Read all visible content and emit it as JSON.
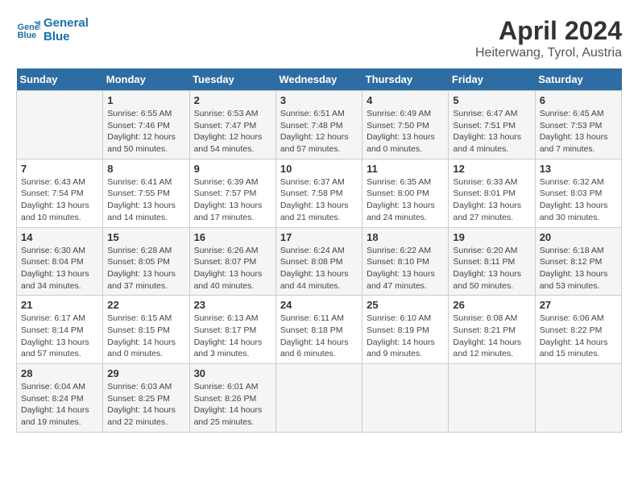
{
  "logo": {
    "line1": "General",
    "line2": "Blue"
  },
  "title": "April 2024",
  "subtitle": "Heiterwang, Tyrol, Austria",
  "days_header": [
    "Sunday",
    "Monday",
    "Tuesday",
    "Wednesday",
    "Thursday",
    "Friday",
    "Saturday"
  ],
  "weeks": [
    [
      {
        "num": "",
        "sunrise": "",
        "sunset": "",
        "daylight": ""
      },
      {
        "num": "1",
        "sunrise": "Sunrise: 6:55 AM",
        "sunset": "Sunset: 7:46 PM",
        "daylight": "Daylight: 12 hours and 50 minutes."
      },
      {
        "num": "2",
        "sunrise": "Sunrise: 6:53 AM",
        "sunset": "Sunset: 7:47 PM",
        "daylight": "Daylight: 12 hours and 54 minutes."
      },
      {
        "num": "3",
        "sunrise": "Sunrise: 6:51 AM",
        "sunset": "Sunset: 7:48 PM",
        "daylight": "Daylight: 12 hours and 57 minutes."
      },
      {
        "num": "4",
        "sunrise": "Sunrise: 6:49 AM",
        "sunset": "Sunset: 7:50 PM",
        "daylight": "Daylight: 13 hours and 0 minutes."
      },
      {
        "num": "5",
        "sunrise": "Sunrise: 6:47 AM",
        "sunset": "Sunset: 7:51 PM",
        "daylight": "Daylight: 13 hours and 4 minutes."
      },
      {
        "num": "6",
        "sunrise": "Sunrise: 6:45 AM",
        "sunset": "Sunset: 7:53 PM",
        "daylight": "Daylight: 13 hours and 7 minutes."
      }
    ],
    [
      {
        "num": "7",
        "sunrise": "Sunrise: 6:43 AM",
        "sunset": "Sunset: 7:54 PM",
        "daylight": "Daylight: 13 hours and 10 minutes."
      },
      {
        "num": "8",
        "sunrise": "Sunrise: 6:41 AM",
        "sunset": "Sunset: 7:55 PM",
        "daylight": "Daylight: 13 hours and 14 minutes."
      },
      {
        "num": "9",
        "sunrise": "Sunrise: 6:39 AM",
        "sunset": "Sunset: 7:57 PM",
        "daylight": "Daylight: 13 hours and 17 minutes."
      },
      {
        "num": "10",
        "sunrise": "Sunrise: 6:37 AM",
        "sunset": "Sunset: 7:58 PM",
        "daylight": "Daylight: 13 hours and 21 minutes."
      },
      {
        "num": "11",
        "sunrise": "Sunrise: 6:35 AM",
        "sunset": "Sunset: 8:00 PM",
        "daylight": "Daylight: 13 hours and 24 minutes."
      },
      {
        "num": "12",
        "sunrise": "Sunrise: 6:33 AM",
        "sunset": "Sunset: 8:01 PM",
        "daylight": "Daylight: 13 hours and 27 minutes."
      },
      {
        "num": "13",
        "sunrise": "Sunrise: 6:32 AM",
        "sunset": "Sunset: 8:03 PM",
        "daylight": "Daylight: 13 hours and 30 minutes."
      }
    ],
    [
      {
        "num": "14",
        "sunrise": "Sunrise: 6:30 AM",
        "sunset": "Sunset: 8:04 PM",
        "daylight": "Daylight: 13 hours and 34 minutes."
      },
      {
        "num": "15",
        "sunrise": "Sunrise: 6:28 AM",
        "sunset": "Sunset: 8:05 PM",
        "daylight": "Daylight: 13 hours and 37 minutes."
      },
      {
        "num": "16",
        "sunrise": "Sunrise: 6:26 AM",
        "sunset": "Sunset: 8:07 PM",
        "daylight": "Daylight: 13 hours and 40 minutes."
      },
      {
        "num": "17",
        "sunrise": "Sunrise: 6:24 AM",
        "sunset": "Sunset: 8:08 PM",
        "daylight": "Daylight: 13 hours and 44 minutes."
      },
      {
        "num": "18",
        "sunrise": "Sunrise: 6:22 AM",
        "sunset": "Sunset: 8:10 PM",
        "daylight": "Daylight: 13 hours and 47 minutes."
      },
      {
        "num": "19",
        "sunrise": "Sunrise: 6:20 AM",
        "sunset": "Sunset: 8:11 PM",
        "daylight": "Daylight: 13 hours and 50 minutes."
      },
      {
        "num": "20",
        "sunrise": "Sunrise: 6:18 AM",
        "sunset": "Sunset: 8:12 PM",
        "daylight": "Daylight: 13 hours and 53 minutes."
      }
    ],
    [
      {
        "num": "21",
        "sunrise": "Sunrise: 6:17 AM",
        "sunset": "Sunset: 8:14 PM",
        "daylight": "Daylight: 13 hours and 57 minutes."
      },
      {
        "num": "22",
        "sunrise": "Sunrise: 6:15 AM",
        "sunset": "Sunset: 8:15 PM",
        "daylight": "Daylight: 14 hours and 0 minutes."
      },
      {
        "num": "23",
        "sunrise": "Sunrise: 6:13 AM",
        "sunset": "Sunset: 8:17 PM",
        "daylight": "Daylight: 14 hours and 3 minutes."
      },
      {
        "num": "24",
        "sunrise": "Sunrise: 6:11 AM",
        "sunset": "Sunset: 8:18 PM",
        "daylight": "Daylight: 14 hours and 6 minutes."
      },
      {
        "num": "25",
        "sunrise": "Sunrise: 6:10 AM",
        "sunset": "Sunset: 8:19 PM",
        "daylight": "Daylight: 14 hours and 9 minutes."
      },
      {
        "num": "26",
        "sunrise": "Sunrise: 6:08 AM",
        "sunset": "Sunset: 8:21 PM",
        "daylight": "Daylight: 14 hours and 12 minutes."
      },
      {
        "num": "27",
        "sunrise": "Sunrise: 6:06 AM",
        "sunset": "Sunset: 8:22 PM",
        "daylight": "Daylight: 14 hours and 15 minutes."
      }
    ],
    [
      {
        "num": "28",
        "sunrise": "Sunrise: 6:04 AM",
        "sunset": "Sunset: 8:24 PM",
        "daylight": "Daylight: 14 hours and 19 minutes."
      },
      {
        "num": "29",
        "sunrise": "Sunrise: 6:03 AM",
        "sunset": "Sunset: 8:25 PM",
        "daylight": "Daylight: 14 hours and 22 minutes."
      },
      {
        "num": "30",
        "sunrise": "Sunrise: 6:01 AM",
        "sunset": "Sunset: 8:26 PM",
        "daylight": "Daylight: 14 hours and 25 minutes."
      },
      {
        "num": "",
        "sunrise": "",
        "sunset": "",
        "daylight": ""
      },
      {
        "num": "",
        "sunrise": "",
        "sunset": "",
        "daylight": ""
      },
      {
        "num": "",
        "sunrise": "",
        "sunset": "",
        "daylight": ""
      },
      {
        "num": "",
        "sunrise": "",
        "sunset": "",
        "daylight": ""
      }
    ]
  ]
}
